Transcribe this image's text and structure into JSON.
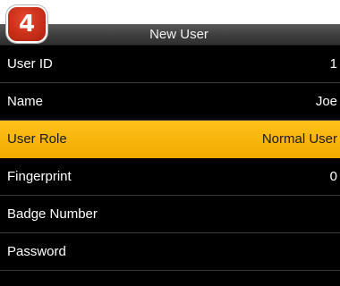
{
  "step_badge": "4",
  "window": {
    "title": "New User"
  },
  "fields": [
    {
      "label": "User ID",
      "value": "1"
    },
    {
      "label": "Name",
      "value": "Joe"
    },
    {
      "label": "User Role",
      "value": "Normal User",
      "selected": true
    },
    {
      "label": "Fingerprint",
      "value": "0"
    },
    {
      "label": "Badge Number",
      "value": ""
    },
    {
      "label": "Password",
      "value": ""
    }
  ],
  "colors": {
    "screen_bg": "#000000",
    "selected_row": "#ffb800",
    "badge": "#d63a20"
  }
}
